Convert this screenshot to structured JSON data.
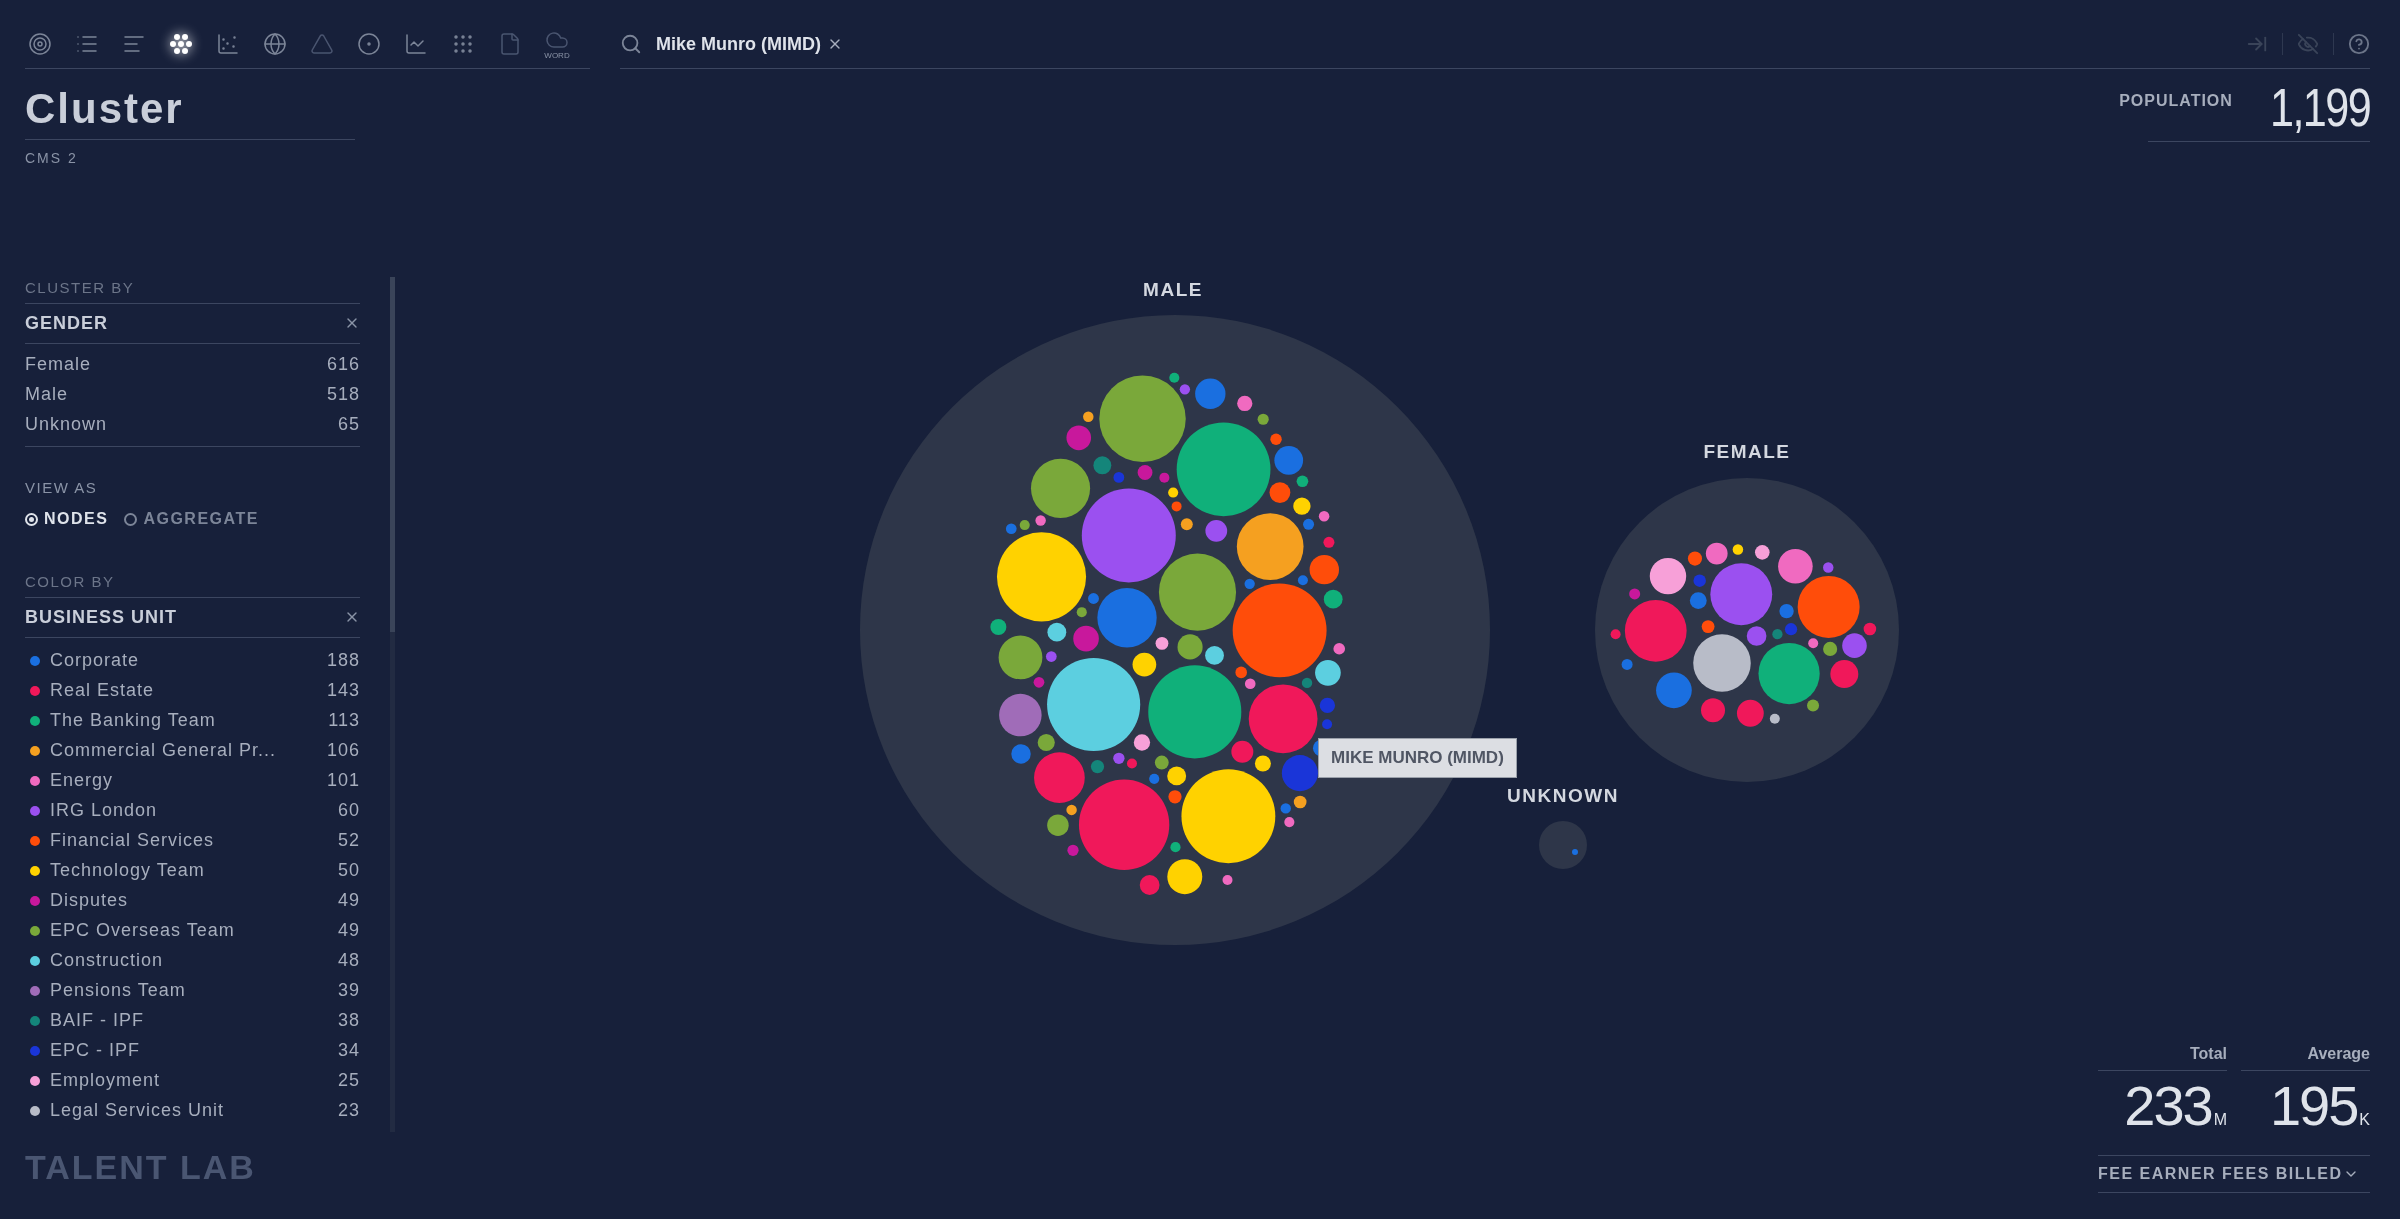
{
  "toolbar": {
    "tools": [
      {
        "kind": "target",
        "selected": false,
        "disabled": false
      },
      {
        "kind": "list",
        "selected": false,
        "disabled": false
      },
      {
        "kind": "bars",
        "selected": false,
        "disabled": false
      },
      {
        "kind": "cluster",
        "selected": true,
        "disabled": false
      },
      {
        "kind": "scatter",
        "selected": false,
        "disabled": false
      },
      {
        "kind": "globe",
        "selected": false,
        "disabled": false
      },
      {
        "kind": "network",
        "selected": false,
        "disabled": true
      },
      {
        "kind": "dot",
        "selected": false,
        "disabled": false
      },
      {
        "kind": "line",
        "selected": false,
        "disabled": false
      },
      {
        "kind": "grid",
        "selected": false,
        "disabled": false
      },
      {
        "kind": "file",
        "selected": false,
        "disabled": true
      },
      {
        "kind": "cloud",
        "selected": false,
        "disabled": true,
        "label": "WORD"
      }
    ]
  },
  "search": {
    "value": "Mike Munro (MIMD)"
  },
  "header_actions": [
    {
      "kind": "export",
      "disabled": true
    },
    {
      "kind": "hide",
      "disabled": true
    },
    {
      "kind": "help",
      "disabled": false
    }
  ],
  "page": {
    "title": "Cluster",
    "subtitle": "CMS 2"
  },
  "sidebar": {
    "cluster_by": {
      "label": "CLUSTER BY",
      "field": "GENDER",
      "items": [
        {
          "name": "Female",
          "count": "616"
        },
        {
          "name": "Male",
          "count": "518"
        },
        {
          "name": "Unknown",
          "count": "65"
        }
      ]
    },
    "view_as": {
      "label": "VIEW AS",
      "options": [
        {
          "label": "NODES",
          "selected": true
        },
        {
          "label": "AGGREGATE",
          "selected": false
        }
      ]
    },
    "color_by": {
      "label": "COLOR BY",
      "field": "BUSINESS UNIT",
      "items": [
        {
          "name": "Corporate",
          "count": "188",
          "color": "#1a6fe0"
        },
        {
          "name": "Real Estate",
          "count": "143",
          "color": "#f0185a"
        },
        {
          "name": "The Banking Team",
          "count": "113",
          "color": "#10b07a"
        },
        {
          "name": "Commercial General Pr...",
          "count": "106",
          "color": "#f5a020"
        },
        {
          "name": "Energy",
          "count": "101",
          "color": "#f06ac0"
        },
        {
          "name": "IRG London",
          "count": "60",
          "color": "#9b50f0"
        },
        {
          "name": "Financial Services",
          "count": "52",
          "color": "#ff4d0a"
        },
        {
          "name": "Technology Team",
          "count": "50",
          "color": "#ffd200"
        },
        {
          "name": "Disputes",
          "count": "49",
          "color": "#c8189c"
        },
        {
          "name": "EPC Overseas Team",
          "count": "49",
          "color": "#7aa83a"
        },
        {
          "name": "Construction",
          "count": "48",
          "color": "#5ccfe0"
        },
        {
          "name": "Pensions Team",
          "count": "39",
          "color": "#a06cb8"
        },
        {
          "name": "BAIF - IPF",
          "count": "38",
          "color": "#14857a"
        },
        {
          "name": "EPC - IPF",
          "count": "34",
          "color": "#1a35d8"
        },
        {
          "name": "Employment",
          "count": "25",
          "color": "#f7a0d8"
        },
        {
          "name": "Legal Services Unit",
          "count": "23",
          "color": "#b8bcc8"
        }
      ]
    }
  },
  "logo": "TALENT LAB",
  "clusters": [
    {
      "label": "MALE"
    },
    {
      "label": "FEMALE"
    },
    {
      "label": "UNKNOWN"
    }
  ],
  "tooltip": "MIKE MUNRO (MIMD)",
  "population": {
    "label": "POPULATION",
    "value": "1,199"
  },
  "metrics": {
    "stats": [
      {
        "label": "Total",
        "value": "233",
        "unit": "M"
      },
      {
        "label": "Average",
        "value": "195",
        "unit": "K"
      }
    ],
    "measure": "FEE EARNER FEES BILLED"
  }
}
